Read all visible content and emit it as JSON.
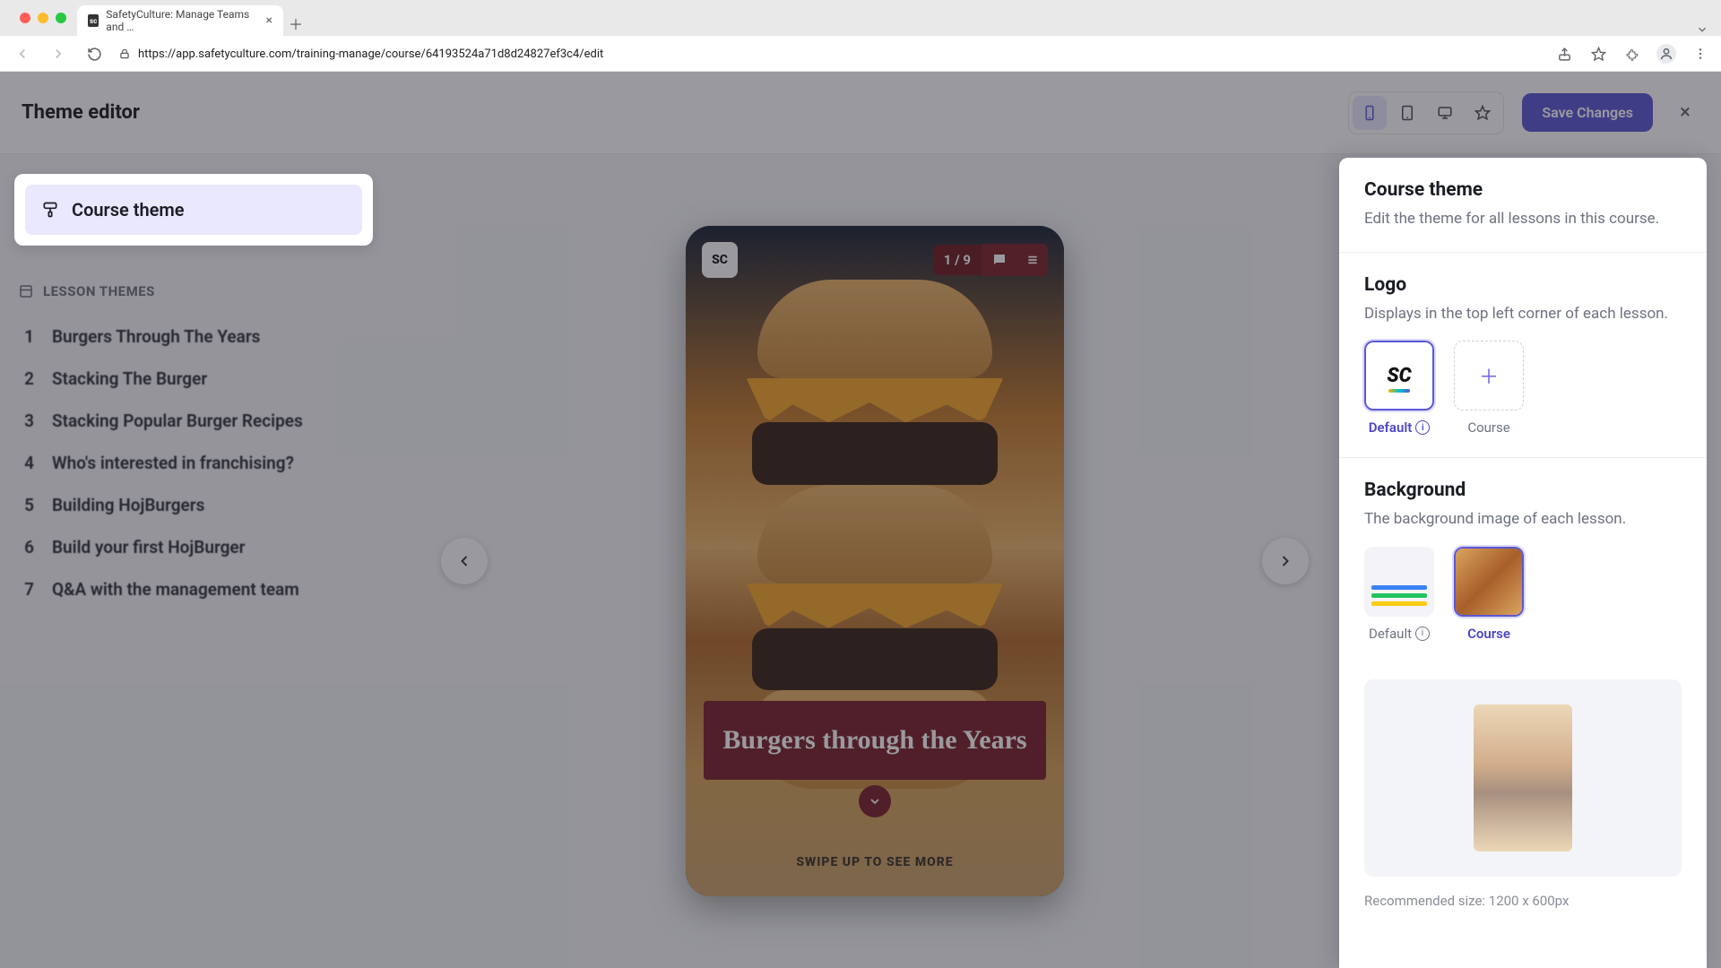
{
  "browser": {
    "tab_title": "SafetyCulture: Manage Teams and …",
    "url": "https://app.safetyculture.com/training-manage/course/64193524a71d8d24827ef3c4/edit"
  },
  "header": {
    "title": "Theme editor",
    "save_label": "Save Changes"
  },
  "sidebar": {
    "course_theme_label": "Course theme",
    "section_label": "LESSON THEMES",
    "lessons": [
      {
        "num": "1",
        "title": "Burgers Through The Years"
      },
      {
        "num": "2",
        "title": "Stacking The Burger"
      },
      {
        "num": "3",
        "title": "Stacking Popular Burger Recipes"
      },
      {
        "num": "4",
        "title": "Who's interested in franchising?"
      },
      {
        "num": "5",
        "title": "Building HojBurgers"
      },
      {
        "num": "6",
        "title": "Build your first HojBurger"
      },
      {
        "num": "7",
        "title": "Q&A with the management team"
      }
    ]
  },
  "preview": {
    "pager": "1 / 9",
    "title": "Burgers through the Years",
    "swipe": "SWIPE UP TO SEE MORE",
    "sc_badge": "SC"
  },
  "panel": {
    "course_theme": {
      "title": "Course theme",
      "desc": "Edit the theme for all lessons in this course."
    },
    "logo": {
      "title": "Logo",
      "desc": "Displays in the top left corner of each lesson.",
      "default_label": "Default",
      "course_label": "Course",
      "sc": "SC"
    },
    "background": {
      "title": "Background",
      "desc": "The background image of each lesson.",
      "default_label": "Default",
      "course_label": "Course",
      "reco": "Recommended size: 1200 x 600px"
    }
  }
}
